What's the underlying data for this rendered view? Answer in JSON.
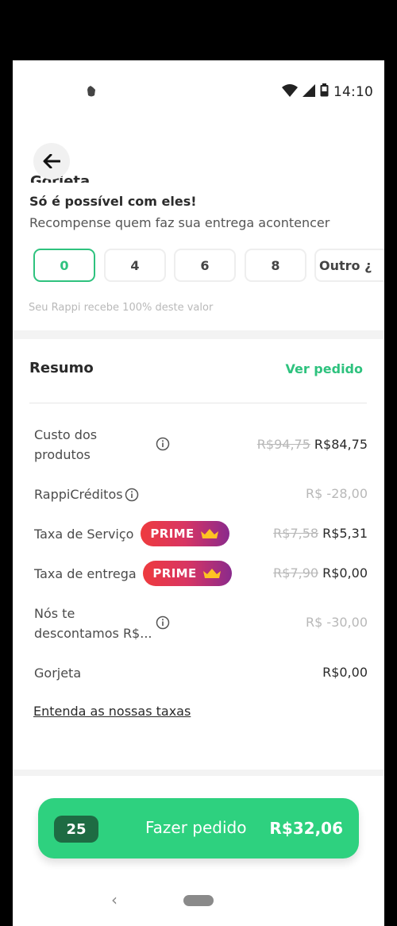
{
  "status_bar": {
    "time": "14:10",
    "icons": [
      "notification-icon",
      "wifi-icon",
      "signal-icon",
      "battery-icon"
    ]
  },
  "tip": {
    "title_partial": "Gorjeta",
    "heading": "Só é possível com eles!",
    "subtitle": "Recompense quem faz sua entrega acontencer",
    "options": [
      {
        "label": "0",
        "selected": true
      },
      {
        "label": "4",
        "selected": false
      },
      {
        "label": "6",
        "selected": false
      },
      {
        "label": "8",
        "selected": false
      },
      {
        "label": "Outro ¿",
        "selected": false
      }
    ],
    "note": "Seu Rappi recebe 100% deste valor"
  },
  "summary": {
    "title": "Resumo",
    "view_order": "Ver pedido",
    "rows": {
      "products": {
        "label_line1": "Custo dos",
        "label_line2": "produtos",
        "old": "R$94,75",
        "value": "R$84,75"
      },
      "credits": {
        "label": "RappiCréditos",
        "value": "R$ -28,00"
      },
      "service_fee": {
        "label": "Taxa de Serviço",
        "old": "R$7,58",
        "value": "R$5,31"
      },
      "delivery_fee": {
        "label": "Taxa de entrega",
        "old": "R$7,90",
        "value": "R$0,00"
      },
      "discount": {
        "label_line1": "Nós te",
        "label_line2": "descontamos R$...",
        "value": "R$ -30,00"
      },
      "tip": {
        "label": "Gorjeta",
        "value": "R$0,00"
      }
    },
    "prime_badge": "PRIME",
    "fees_link": "Entenda as nossas taxas"
  },
  "cta": {
    "count": "25",
    "label": "Fazer pedido",
    "total": "R$32,06"
  },
  "nav": {
    "back_glyph": "‹"
  },
  "colors": {
    "accent": "#2ec27e",
    "cta": "#2ed17f",
    "cta_badge": "#1e6b43",
    "prime_start": "#ee3b3e",
    "prime_end": "#8a2a8c"
  }
}
